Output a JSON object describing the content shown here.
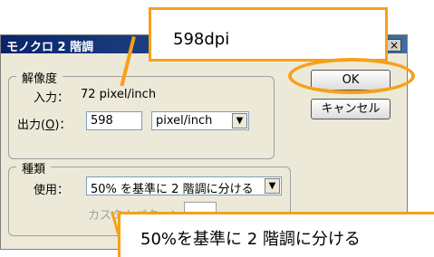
{
  "dialog": {
    "title": "モノクロ 2 階調",
    "close_symbol": "×",
    "resolution": {
      "group_label": "解像度",
      "input_label": "入力：",
      "input_value": "72 pixel/inch",
      "output_label_prefix": "出力(",
      "output_label_accel": "O",
      "output_label_suffix": ")：",
      "output_value": "598",
      "unit_selected": "pixel/inch",
      "dropdown_arrow": "▼"
    },
    "method": {
      "group_label": "種類",
      "use_label": "使用：",
      "use_selected": "50% を基準に 2 階調に分ける",
      "custom_pattern_label": "カスタムパターン："
    },
    "buttons": {
      "ok": "OK",
      "cancel": "キャンセル"
    }
  },
  "callouts": {
    "dpi": "598dpi",
    "method": "50%を基準に 2 階調に分ける",
    "accent_color": "#f6a01a"
  }
}
